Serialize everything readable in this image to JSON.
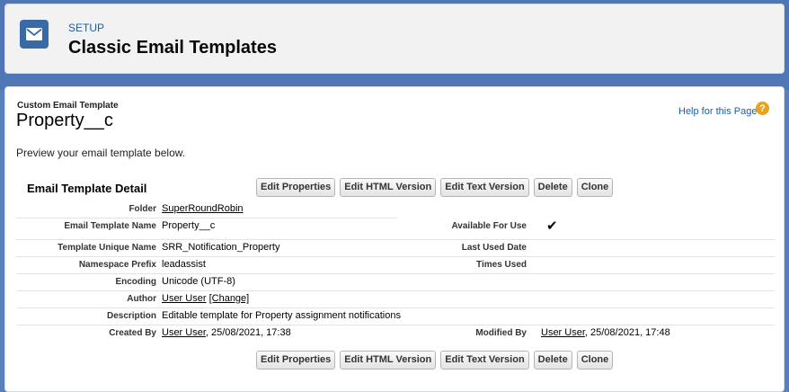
{
  "header": {
    "setup_label": "SETUP",
    "title": "Classic Email Templates",
    "icon": "email-icon"
  },
  "page": {
    "breadcrumb": "Custom Email Template",
    "name": "Property__c",
    "help_link": "Help for this Page",
    "help_icon_glyph": "?",
    "preview_text": "Preview your email template below."
  },
  "detail": {
    "title": "Email Template Detail",
    "buttons": {
      "edit_properties": "Edit Properties",
      "edit_html": "Edit HTML Version",
      "edit_text": "Edit Text Version",
      "delete": "Delete",
      "clone": "Clone"
    },
    "fields": {
      "folder_label": "Folder",
      "folder_value": "SuperRoundRobin",
      "template_name_label": "Email Template Name",
      "template_name_value": "Property__c",
      "available_label": "Available For Use",
      "available_value": "✔",
      "unique_name_label": "Template Unique Name",
      "unique_name_value": "SRR_Notification_Property",
      "last_used_label": "Last Used Date",
      "namespace_label": "Namespace Prefix",
      "namespace_value": "leadassist",
      "times_used_label": "Times Used",
      "encoding_label": "Encoding",
      "encoding_value": "Unicode (UTF-8)",
      "author_label": "Author",
      "author_value": "User User",
      "author_change": "[Change]",
      "description_label": "Description",
      "description_value": "Editable template for Property assignment notifications",
      "created_by_label": "Created By",
      "created_by_user": "User User",
      "created_by_date": ", 25/08/2021, 17:38",
      "modified_by_label": "Modified By",
      "modified_by_user": "User User",
      "modified_by_date": ", 25/08/2021, 17:48"
    }
  }
}
